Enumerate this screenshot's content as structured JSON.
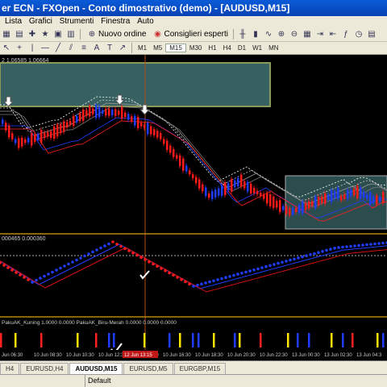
{
  "window": {
    "title": "er ECN - FXOpen - Conto dimostrativo (demo) - [AUDUSD,M15]"
  },
  "menu": [
    "Lista",
    "Grafici",
    "Strumenti",
    "Finestra",
    "Auto"
  ],
  "toolbar": {
    "new_order": "Nuovo ordine",
    "experts": "Consiglieri esperti",
    "timeframes": [
      "M1",
      "M5",
      "M15",
      "M30",
      "H1",
      "H4",
      "D1",
      "W1",
      "MN"
    ],
    "active_timeframe": "M15"
  },
  "chart": {
    "info_line": "2 1.06585 1.06664",
    "osc_label": "000465 0.000360",
    "sub_label": "PakuAK_Kuning 1.0000 0.0000  PakuAK_Biru-Merah 0.0000 0.0000 0.0000",
    "price_time_box": "12 Jun 13:15",
    "time_labels": [
      "Jun 06:30",
      "10 Jun 08:30",
      "10 Jun 10:30",
      "10 Jun 12:30",
      "10 Jun 14:30",
      "10 Jun 16:30",
      "10 Jun 18:30",
      "10 Jun 20:30",
      "10 Jun 22:30",
      "13 Jun 00:30",
      "13 Jun 02:30",
      "13 Jun 04:3"
    ],
    "colors": {
      "bull": "#1f3cff",
      "bear": "#ff1a1a",
      "box": "#4a8080",
      "ma": "#ffffff"
    }
  },
  "tabs": [
    {
      "label": "H4",
      "active": false
    },
    {
      "label": "EURUSD,H4",
      "active": false
    },
    {
      "label": "AUDUSD,M15",
      "active": true
    },
    {
      "label": "EURUSD,M5",
      "active": false
    },
    {
      "label": "EURGBP,M15",
      "active": false
    }
  ],
  "status": {
    "help": "",
    "profile": "Default"
  }
}
